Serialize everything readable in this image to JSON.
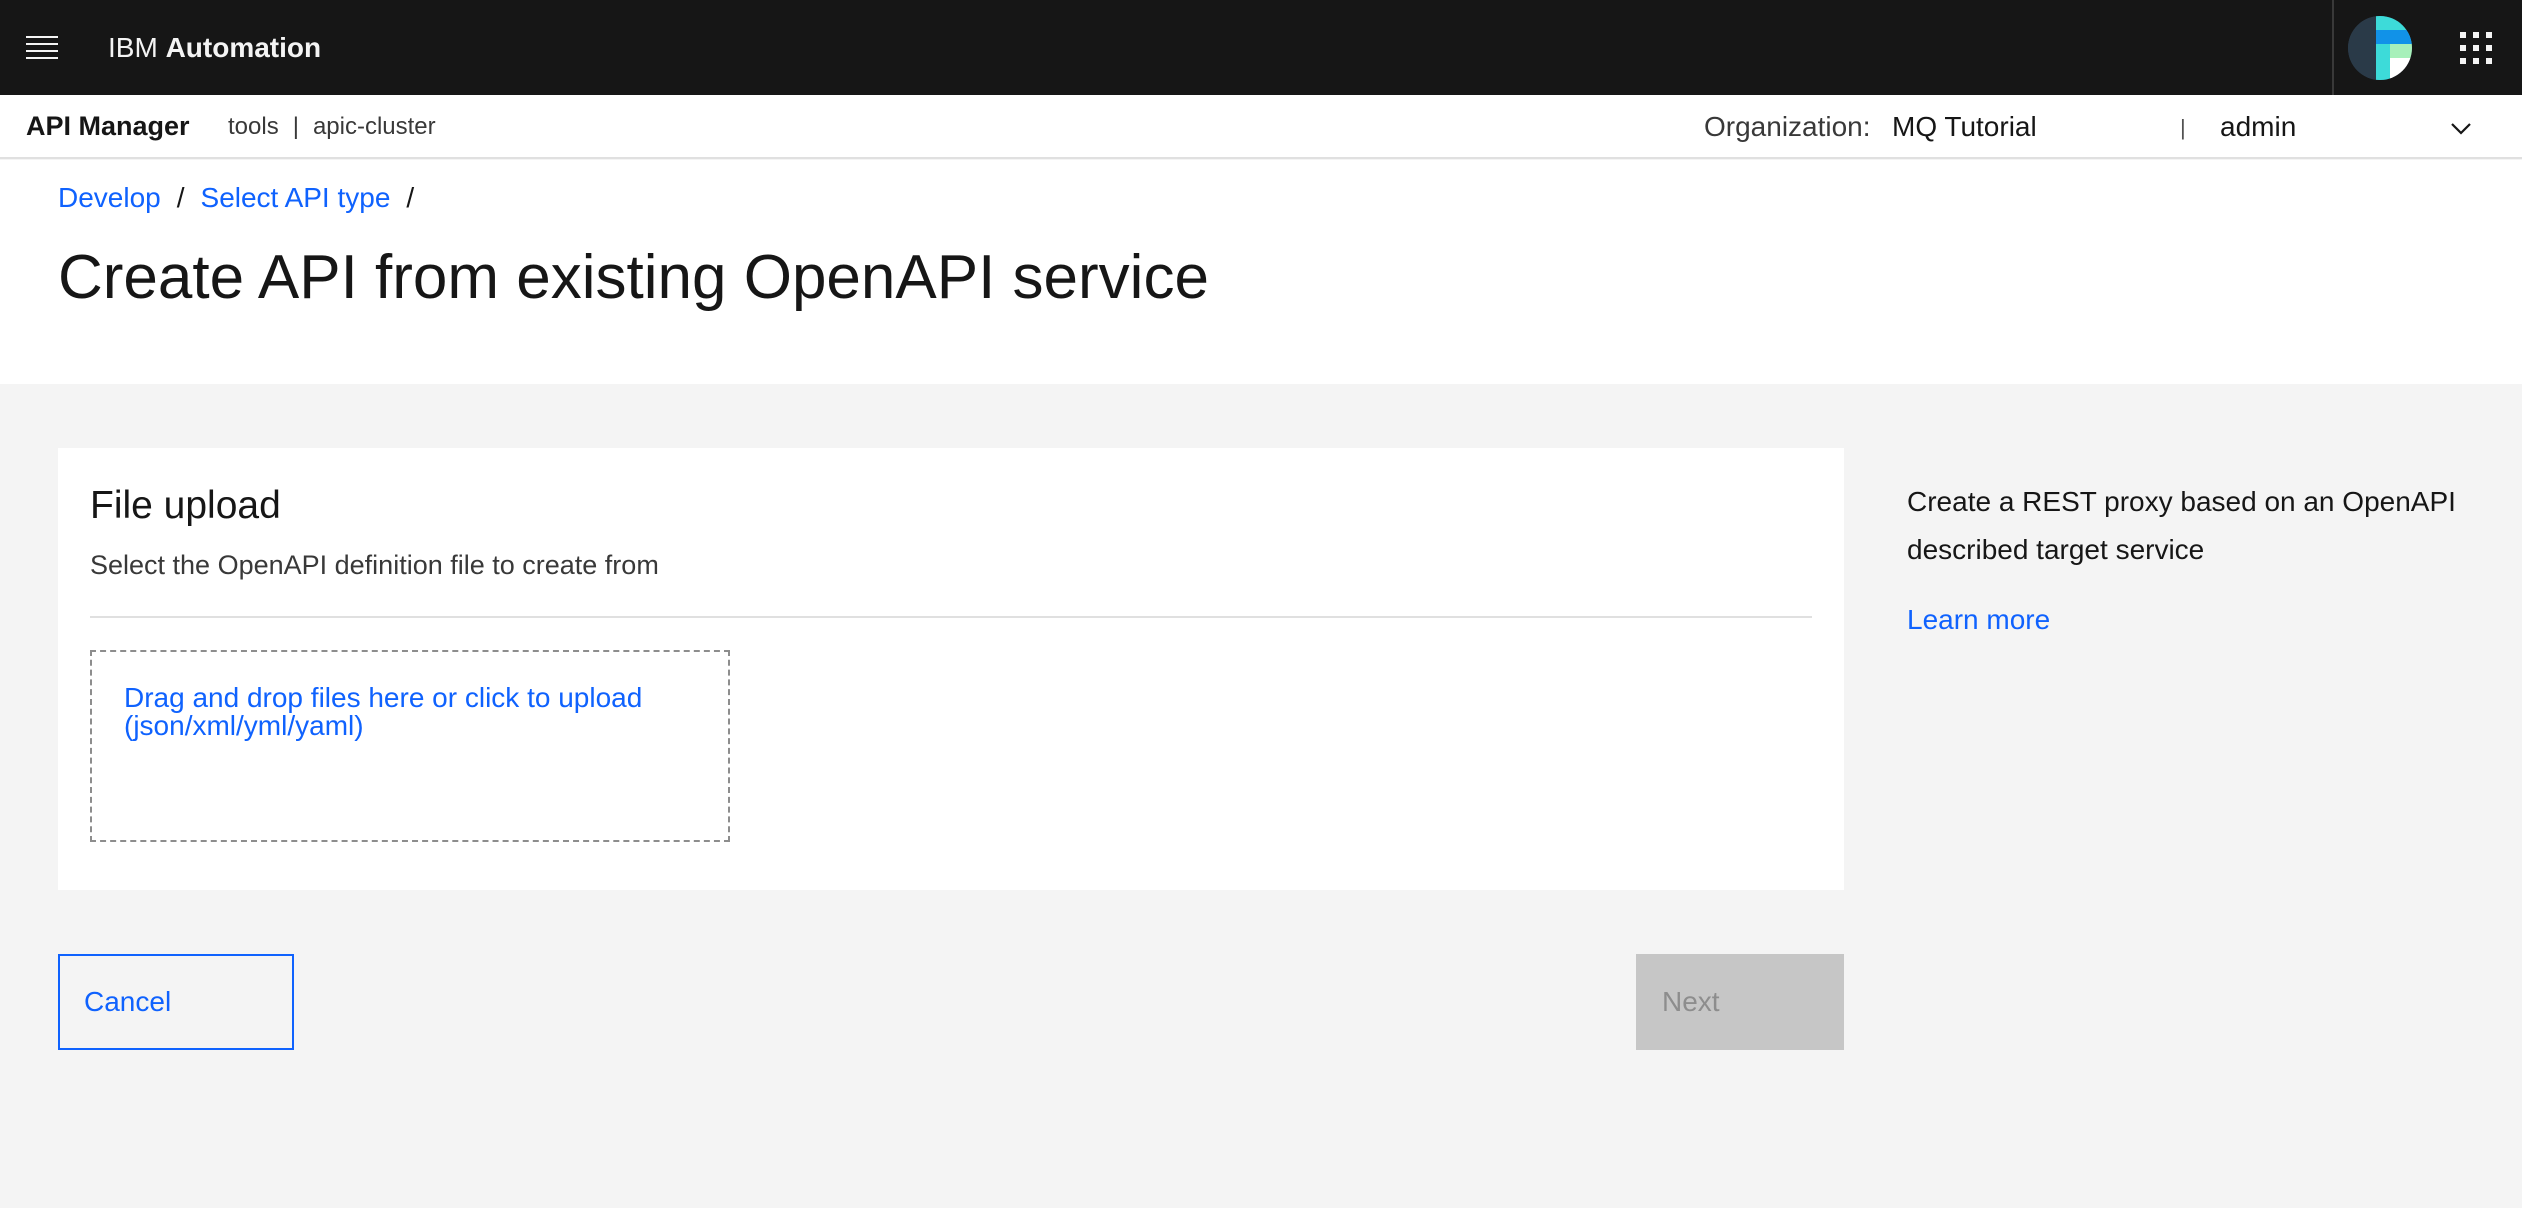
{
  "topbar": {
    "brand_prefix": "IBM",
    "brand_name": "Automation",
    "icons": [
      "menu-icon",
      "avatar-icon",
      "app-switcher-icon"
    ]
  },
  "subheader": {
    "title": "API Manager",
    "crumb_1": "tools",
    "separator": "|",
    "crumb_2": "apic-cluster",
    "org_label": "Organization:",
    "org_value": "MQ Tutorial",
    "user_separator": "|",
    "user": "admin"
  },
  "breadcrumb": {
    "items": [
      {
        "label": "Develop"
      },
      {
        "label": "Select API type"
      }
    ],
    "separator": "/"
  },
  "page_title": "Create API from existing OpenAPI service",
  "card": {
    "title": "File upload",
    "description": "Select the OpenAPI definition file to create from",
    "dropzone_line1": "Drag and drop files here or click to upload",
    "dropzone_line2": "(json/xml/yml/yaml)"
  },
  "help": {
    "text": "Create a REST proxy based on an OpenAPI described target service",
    "link": "Learn more"
  },
  "buttons": {
    "cancel": "Cancel",
    "next": "Next"
  },
  "colors": {
    "topbar_bg": "#161616",
    "link": "#0f62fe",
    "page_bg": "#f4f4f4",
    "disabled_bg": "#c6c6c6",
    "avatar_accent": "#3ddbd9"
  }
}
